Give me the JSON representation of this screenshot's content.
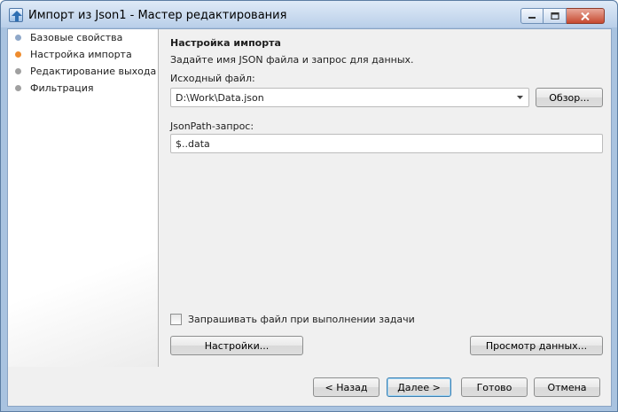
{
  "window": {
    "title": "Импорт из Json1 - Мастер редактирования",
    "icon": "wizard-app-icon",
    "controls": [
      "minimize-icon",
      "maximize-icon",
      "close-icon"
    ]
  },
  "sidebar": {
    "steps": [
      {
        "label": "Базовые свойства",
        "state": "done"
      },
      {
        "label": "Настройка импорта",
        "state": "active"
      },
      {
        "label": "Редактирование выхода",
        "state": "todo"
      },
      {
        "label": "Фильтрация",
        "state": "todo"
      }
    ]
  },
  "main": {
    "heading": "Настройка импорта",
    "description": "Задайте имя JSON файла и запрос для данных.",
    "source_file_label": "Исходный файл:",
    "source_file_value": "D:\\Work\\Data.json",
    "browse_button": "Обзор...",
    "jsonpath_label": "JsonPath-запрос:",
    "jsonpath_value": "$..data",
    "ask_file_checkbox": {
      "label": "Запрашивать файл при выполнении задачи",
      "checked": false
    },
    "settings_button": "Настройки...",
    "preview_button": "Просмотр данных..."
  },
  "footer": {
    "back_button": "< Назад",
    "next_button": "Далее >",
    "finish_button": "Готово",
    "cancel_button": "Отмена"
  },
  "colors": {
    "active_step": "#ee8c2e",
    "done_step": "#8fa8c9",
    "todo_step": "#a0a0a0",
    "titlebar": "#b9cfe9",
    "close_button": "#c6492f"
  }
}
